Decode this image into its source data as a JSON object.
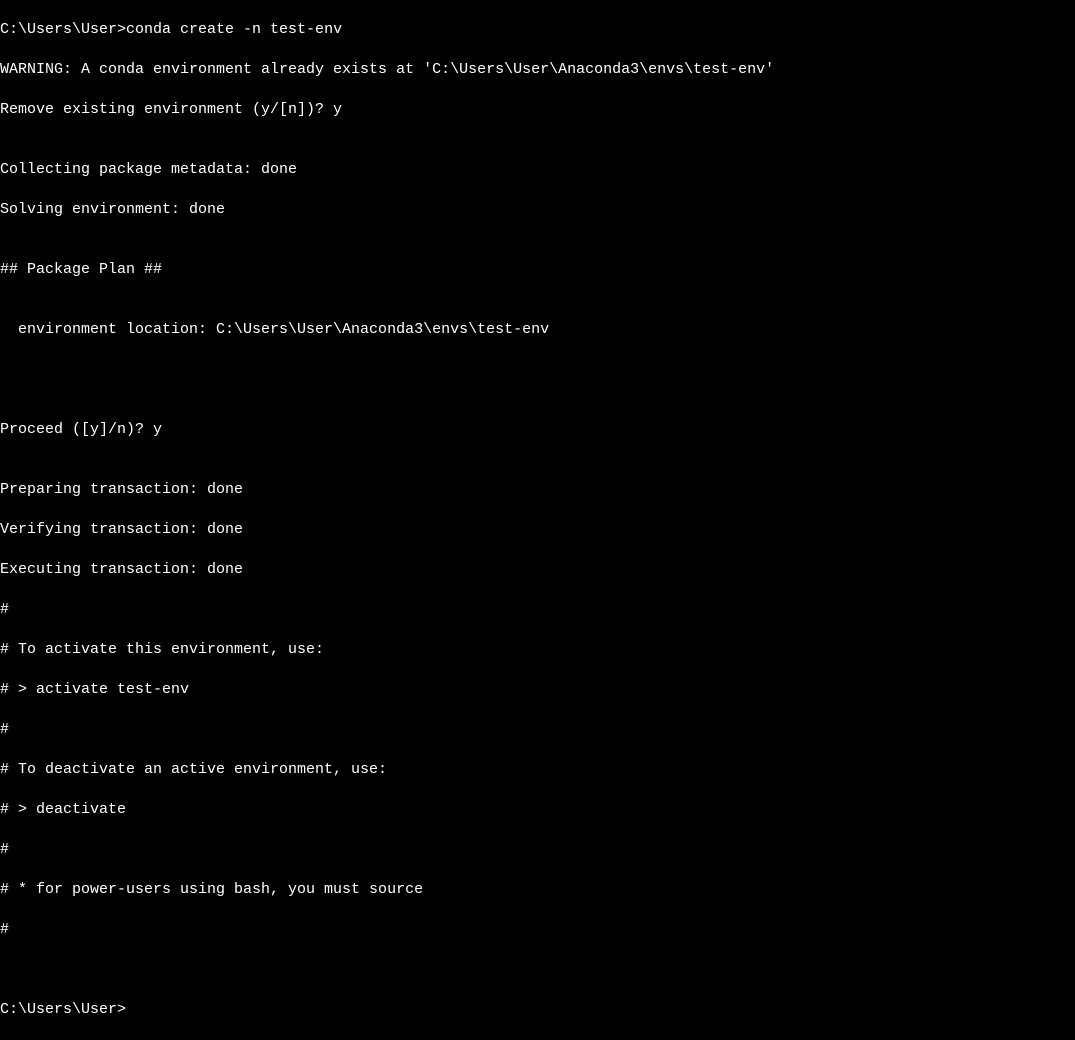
{
  "terminal": {
    "lines": [
      {
        "prompt": "C:\\Users\\User>",
        "command": "conda create -n test-env"
      },
      {
        "text": "WARNING: A conda environment already exists at 'C:\\Users\\User\\Anaconda3\\envs\\test-env'"
      },
      {
        "text": "Remove existing environment (y/[n])? y"
      },
      {
        "text": ""
      },
      {
        "text": "Collecting package metadata: done"
      },
      {
        "text": "Solving environment: done"
      },
      {
        "text": ""
      },
      {
        "text": "## Package Plan ##"
      },
      {
        "text": ""
      },
      {
        "text": "  environment location: C:\\Users\\User\\Anaconda3\\envs\\test-env"
      },
      {
        "text": ""
      },
      {
        "text": ""
      },
      {
        "text": ""
      },
      {
        "text": "Proceed ([y]/n)? y"
      },
      {
        "text": ""
      },
      {
        "text": "Preparing transaction: done"
      },
      {
        "text": "Verifying transaction: done"
      },
      {
        "text": "Executing transaction: done"
      },
      {
        "text": "#"
      },
      {
        "text": "# To activate this environment, use:"
      },
      {
        "text": "# > activate test-env"
      },
      {
        "text": "#"
      },
      {
        "text": "# To deactivate an active environment, use:"
      },
      {
        "text": "# > deactivate"
      },
      {
        "text": "#"
      },
      {
        "text": "# * for power-users using bash, you must source"
      },
      {
        "text": "#"
      },
      {
        "text": ""
      },
      {
        "text": ""
      },
      {
        "prompt": "C:\\Users\\User>",
        "command": ""
      }
    ]
  }
}
